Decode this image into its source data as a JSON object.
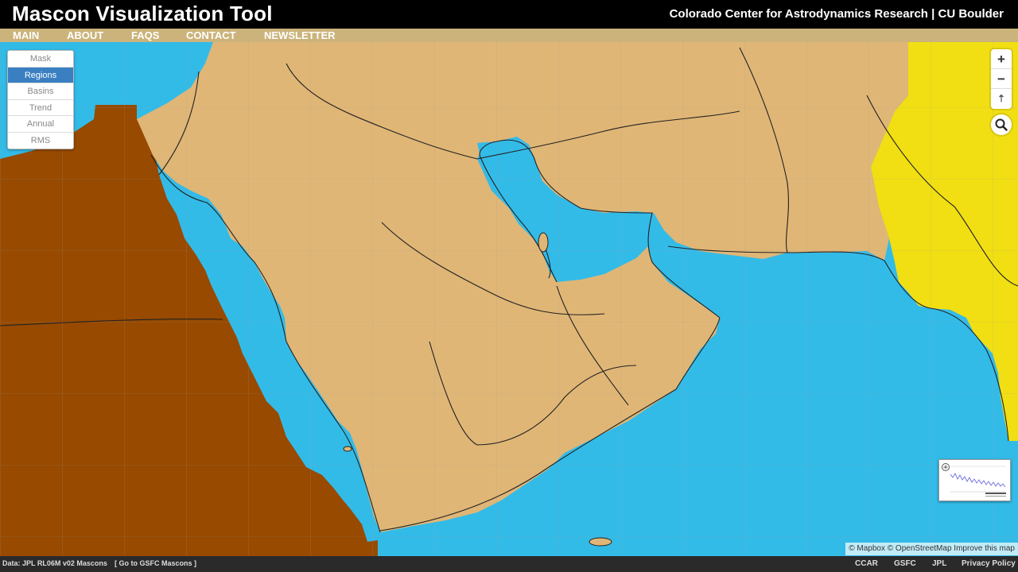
{
  "header": {
    "app_title": "Mascon Visualization Tool",
    "org_title": "Colorado Center for Astrodynamics Research | CU Boulder"
  },
  "nav": {
    "items": [
      "MAIN",
      "ABOUT",
      "FAQS",
      "CONTACT",
      "NEWSLETTER"
    ]
  },
  "layers": {
    "items": [
      "Mask",
      "Regions",
      "Basins",
      "Trend",
      "Annual",
      "RMS"
    ],
    "active": "Regions"
  },
  "map_controls": {
    "zoom_in": "+",
    "zoom_out": "−",
    "reset_north": "⇡",
    "icons": [
      "zoom-in-icon",
      "zoom-out-icon",
      "compass-icon",
      "search-icon"
    ]
  },
  "map": {
    "colors": {
      "ocean": "#33bbe8",
      "arabia_region": "#e0b676",
      "africa_region": "#974a00",
      "south_asia_region": "#f1df13",
      "borders": "#222222",
      "grid": "#999999"
    }
  },
  "attribution": {
    "mapbox": "© Mapbox",
    "osm": "© OpenStreetMap",
    "improve": "Improve this map"
  },
  "footer": {
    "data_label": "Data: JPL RL06M v02 Mascons",
    "gsfc_link": "[ Go to GSFC Mascons ]",
    "links": [
      "CCAR",
      "GSFC",
      "JPL",
      "Privacy Policy"
    ]
  }
}
